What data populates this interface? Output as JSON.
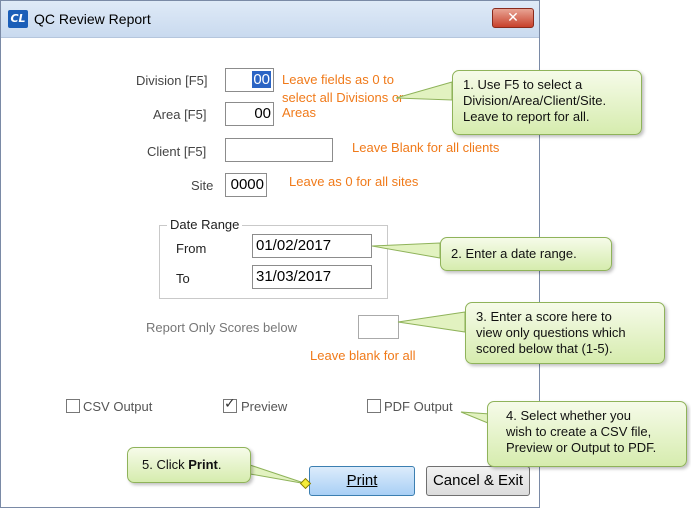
{
  "window": {
    "title": "QC Review Report",
    "app_icon": "CL",
    "close_label": "✕"
  },
  "fields": {
    "division": {
      "label": "Division [F5]",
      "value": "00",
      "hint": "Leave fields as 0 to\nselect all Divisions or"
    },
    "area": {
      "label": "Area [F5]",
      "value": "00",
      "hint": "Areas"
    },
    "client": {
      "label": "Client [F5]",
      "value": "",
      "hint": "Leave Blank for all clients"
    },
    "site": {
      "label": "Site",
      "value": "0000",
      "hint": "Leave as 0 for all sites"
    }
  },
  "date_range": {
    "title": "Date Range",
    "from_label": "From",
    "from_value": "01/02/2017",
    "to_label": "To",
    "to_value": "31/03/2017"
  },
  "score": {
    "label": "Report Only Scores below",
    "value": "",
    "hint": "Leave blank for all"
  },
  "options": {
    "csv": {
      "label": "CSV Output",
      "checked": false
    },
    "preview": {
      "label": "Preview",
      "checked": true
    },
    "pdf": {
      "label": "PDF Output",
      "checked": false
    }
  },
  "buttons": {
    "print": "Print",
    "cancel": "Cancel & Exit"
  },
  "callouts": {
    "c1": "1. Use F5 to select a\nDivision/Area/Client/Site.\nLeave to report for all.",
    "c2": "2. Enter a date range.",
    "c3": "3. Enter a score here to\nview only questions which\nscored below that (1-5).",
    "c4": "4. Select whether you\nwish to create a CSV file,\nPreview or Output to PDF.",
    "c5_prefix": "5. Click ",
    "c5_bold": "Print",
    "c5_suffix": "."
  },
  "colors": {
    "hint_orange": "#f07a1a",
    "callout_green": "#d6ecae",
    "selection_blue": "#2b64c4"
  }
}
